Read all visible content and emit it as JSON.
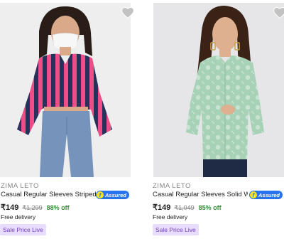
{
  "products": [
    {
      "brand": "ZIMA LETO",
      "title": "Casual Regular Sleeves Striped W...",
      "assured": "Assured",
      "price": "₹149",
      "mrp": "₹1,299",
      "discount": "88% off",
      "delivery": "Free delivery",
      "badge": "Sale Price Live",
      "wishlist_icon": "heart-icon"
    },
    {
      "brand": "ZIMA LETO",
      "title": "Casual Regular Sleeves Solid Wo...",
      "assured": "Assured",
      "price": "₹149",
      "mrp": "₹1,049",
      "discount": "85% off",
      "delivery": "Free delivery",
      "badge": "Sale Price Live",
      "wishlist_icon": "heart-icon"
    }
  ],
  "colors": {
    "assured_blue": "#2874f0",
    "discount_green": "#388e3c",
    "badge_bg": "#e9ddff",
    "badge_text": "#6f3fbf"
  }
}
